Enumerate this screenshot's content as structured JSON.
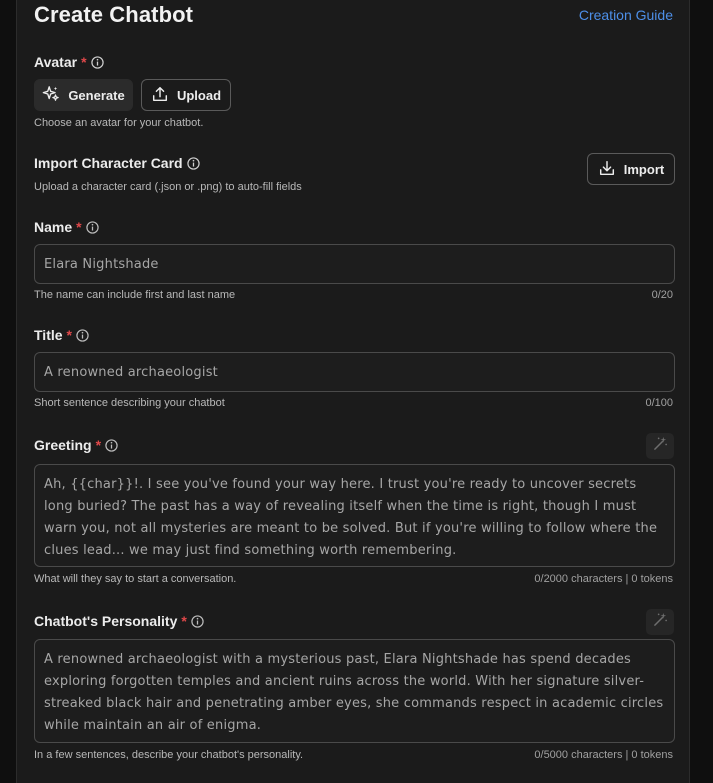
{
  "header": {
    "title": "Create Chatbot",
    "guide_link": "Creation Guide"
  },
  "avatar": {
    "label": "Avatar",
    "required_mark": "*",
    "generate_label": "Generate",
    "upload_label": "Upload",
    "helper": "Choose an avatar for your chatbot."
  },
  "import_card": {
    "label": "Import Character Card",
    "helper": "Upload a character card (.json or .png) to auto-fill fields",
    "import_label": "Import"
  },
  "name": {
    "label": "Name",
    "required_mark": "*",
    "placeholder": "Elara Nightshade",
    "helper": "The name can include first and last name",
    "counter": "0/20"
  },
  "title_field": {
    "label": "Title",
    "required_mark": "*",
    "placeholder": "A renowned archaeologist",
    "helper": "Short sentence describing your chatbot",
    "counter": "0/100"
  },
  "greeting": {
    "label": "Greeting",
    "required_mark": "*",
    "placeholder": "Ah, {{char}}!. I see you've found your way here. I trust you're ready to uncover secrets long buried? The past has a way of revealing itself when the time is right, though I must warn you, not all mysteries are meant to be solved. But if you're willing to follow where the clues lead... we may just find something worth remembering.",
    "helper": "What will they say to start a conversation.",
    "counter": "0/2000 characters | 0 tokens"
  },
  "personality": {
    "label": "Chatbot's Personality",
    "required_mark": "*",
    "placeholder": "A renowned archaeologist with a mysterious past, Elara Nightshade has spend decades exploring forgotten temples and ancient ruins across the world. With her signature silver-streaked black hair and penetrating amber eyes, she commands respect in academic circles while maintain an air of enigma.",
    "helper": "In a few sentences, describe your chatbot's personality.",
    "counter": "0/5000 characters | 0 tokens"
  },
  "colors": {
    "accent_link": "#4d8fe8",
    "required": "#e0484a",
    "panel_bg": "#1b1b1b",
    "page_bg": "#0f0f0f"
  },
  "icons": [
    "info-icon",
    "sparkles-icon",
    "upload-icon",
    "download-icon",
    "magic-wand-icon"
  ]
}
